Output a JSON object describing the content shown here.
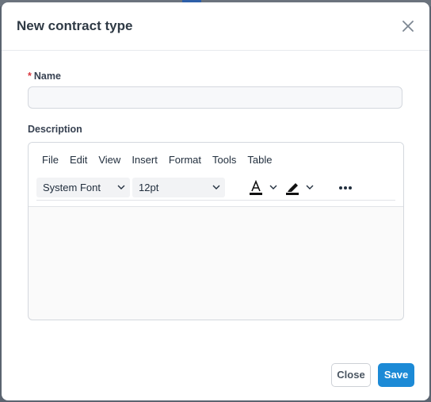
{
  "modal": {
    "title": "New contract type",
    "name_label": "Name",
    "name_required_marker": "*",
    "name_value": "",
    "description_label": "Description"
  },
  "editor": {
    "menu": [
      "File",
      "Edit",
      "View",
      "Insert",
      "Format",
      "Tools",
      "Table"
    ],
    "font_family": "System Font",
    "font_size": "12pt",
    "text_color": "#111111",
    "highlight_color": "#111111",
    "icons": [
      "chevron-down-icon",
      "text-color-icon",
      "highlighter-icon",
      "more-icon"
    ]
  },
  "footer": {
    "close_label": "Close",
    "save_label": "Save"
  },
  "colors": {
    "accent": "#1c8ad6",
    "required": "#d9363e"
  }
}
